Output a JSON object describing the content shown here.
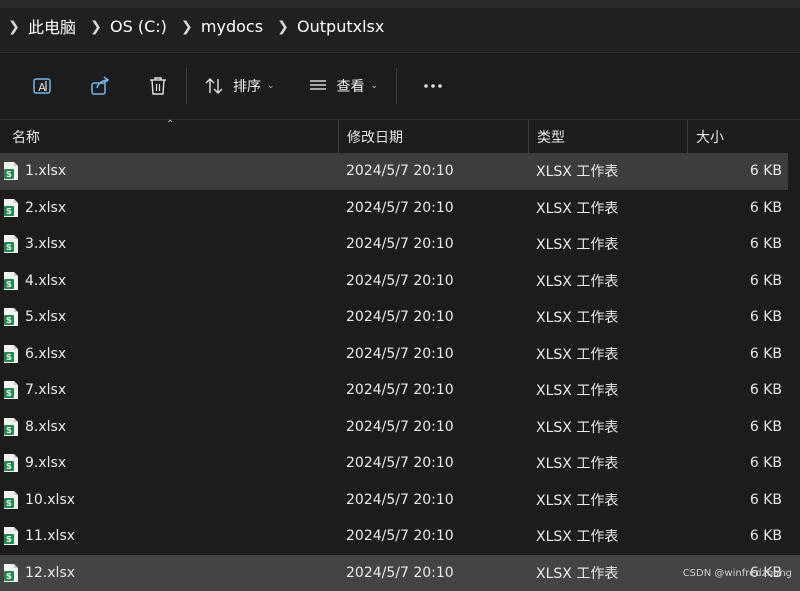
{
  "breadcrumb": {
    "items": [
      "此电脑",
      "OS (C:)",
      "mydocs",
      "Outputxlsx"
    ]
  },
  "toolbar": {
    "sort_label": "排序",
    "view_label": "查看",
    "icons": [
      "rename-icon",
      "share-icon",
      "trash-icon",
      "sort-icon",
      "view-icon",
      "more-icon"
    ]
  },
  "columns": {
    "name": "名称",
    "date": "修改日期",
    "type": "类型",
    "size": "大小"
  },
  "files": [
    {
      "name": "1.xlsx",
      "date": "2024/5/7 20:10",
      "type": "XLSX 工作表",
      "size": "6 KB",
      "selected": true
    },
    {
      "name": "2.xlsx",
      "date": "2024/5/7 20:10",
      "type": "XLSX 工作表",
      "size": "6 KB",
      "selected": false
    },
    {
      "name": "3.xlsx",
      "date": "2024/5/7 20:10",
      "type": "XLSX 工作表",
      "size": "6 KB",
      "selected": false
    },
    {
      "name": "4.xlsx",
      "date": "2024/5/7 20:10",
      "type": "XLSX 工作表",
      "size": "6 KB",
      "selected": false
    },
    {
      "name": "5.xlsx",
      "date": "2024/5/7 20:10",
      "type": "XLSX 工作表",
      "size": "6 KB",
      "selected": false
    },
    {
      "name": "6.xlsx",
      "date": "2024/5/7 20:10",
      "type": "XLSX 工作表",
      "size": "6 KB",
      "selected": false
    },
    {
      "name": "7.xlsx",
      "date": "2024/5/7 20:10",
      "type": "XLSX 工作表",
      "size": "6 KB",
      "selected": false
    },
    {
      "name": "8.xlsx",
      "date": "2024/5/7 20:10",
      "type": "XLSX 工作表",
      "size": "6 KB",
      "selected": false
    },
    {
      "name": "9.xlsx",
      "date": "2024/5/7 20:10",
      "type": "XLSX 工作表",
      "size": "6 KB",
      "selected": false
    },
    {
      "name": "10.xlsx",
      "date": "2024/5/7 20:10",
      "type": "XLSX 工作表",
      "size": "6 KB",
      "selected": false
    },
    {
      "name": "11.xlsx",
      "date": "2024/5/7 20:10",
      "type": "XLSX 工作表",
      "size": "6 KB",
      "selected": false
    },
    {
      "name": "12.xlsx",
      "date": "2024/5/7 20:10",
      "type": "XLSX 工作表",
      "size": "6 KB",
      "selected": true
    }
  ],
  "file_icon": "excel-file-icon",
  "colors": {
    "background": "#1c1c1c",
    "selected_row": "#444444",
    "excel_green": "#1f8a4c"
  },
  "watermark": "CSDN @winfredzhang"
}
